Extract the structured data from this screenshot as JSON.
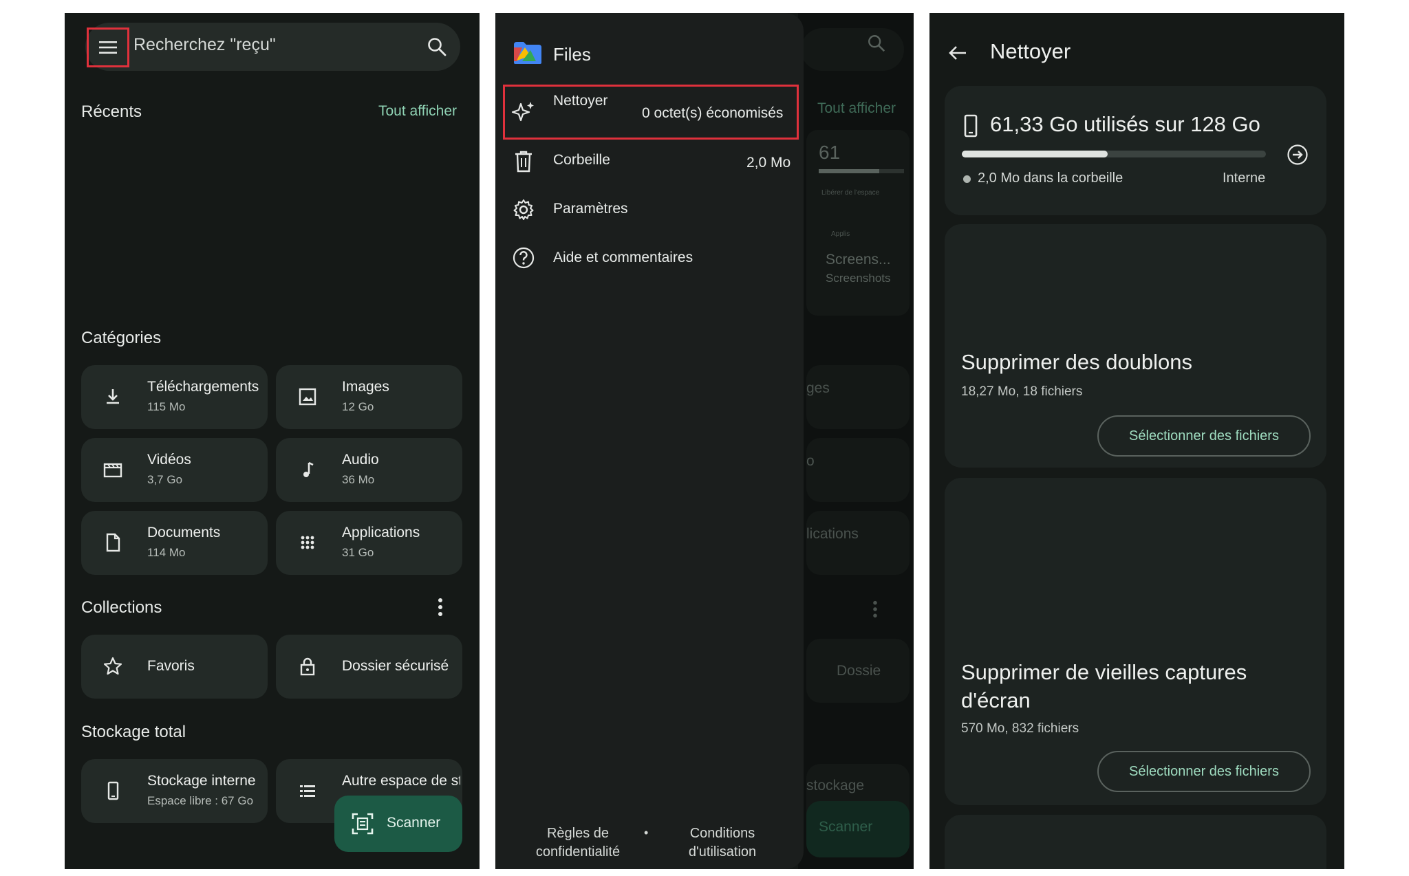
{
  "panel1": {
    "search": {
      "placeholder": "Recherchez \"reçu\""
    },
    "recents": {
      "title": "Récents",
      "action": "Tout afficher"
    },
    "categories": {
      "title": "Catégories",
      "items": [
        {
          "label": "Téléchargements",
          "size": "115 Mo",
          "icon": "download-icon"
        },
        {
          "label": "Images",
          "size": "12 Go",
          "icon": "image-icon"
        },
        {
          "label": "Vidéos",
          "size": "3,7 Go",
          "icon": "video-icon"
        },
        {
          "label": "Audio",
          "size": "36 Mo",
          "icon": "music-note-icon"
        },
        {
          "label": "Documents",
          "size": "114 Mo",
          "icon": "document-icon"
        },
        {
          "label": "Applications",
          "size": "31 Go",
          "icon": "apps-grid-icon"
        }
      ]
    },
    "collections": {
      "title": "Collections",
      "items": [
        {
          "label": "Favoris",
          "icon": "star-icon"
        },
        {
          "label": "Dossier sécurisé",
          "icon": "lock-icon"
        }
      ]
    },
    "storage": {
      "title": "Stockage total",
      "items": [
        {
          "label": "Stockage interne",
          "sub": "Espace libre : 67 Go",
          "icon": "phone-icon"
        },
        {
          "label": "Autre espace de stockage",
          "sub": "",
          "icon": "storage-list-icon"
        }
      ]
    },
    "fab": {
      "label": "Scanner",
      "icon": "document-scanner-icon"
    }
  },
  "panel2": {
    "app_title": "Files",
    "items": [
      {
        "label": "Nettoyer",
        "value": "0 octet(s) économisés",
        "icon": "sparkle-icon"
      },
      {
        "label": "Corbeille",
        "value": "2,0 Mo",
        "icon": "trash-icon"
      },
      {
        "label": "Paramètres",
        "value": "",
        "icon": "gear-icon"
      },
      {
        "label": "Aide et commentaires",
        "value": "",
        "icon": "help-icon"
      }
    ],
    "footer": {
      "privacy": "Règles de confidentialité",
      "separator": "•",
      "terms": "Conditions d'utilisation"
    },
    "background": {
      "tout_afficher": "Tout afficher",
      "storage_number": "61",
      "liberer": "Libérer de l'espace",
      "applis": "Applis",
      "screens": "Screens...",
      "screenshots": "Screenshots",
      "images_frag": "ges",
      "audio_frag": "o",
      "apps_frag": "lications",
      "dossier_frag": "Dossie",
      "stockage_frag": "stockage",
      "scanner": "Scanner"
    }
  },
  "panel3": {
    "title": "Nettoyer",
    "storage": {
      "headline": "61,33 Go utilisés sur 128 Go",
      "used_fraction": 0.479,
      "trash": "2,0 Mo dans la corbeille",
      "location": "Interne"
    },
    "cards": [
      {
        "title": "Supprimer des doublons",
        "subtitle": "18,27 Mo, 18 fichiers",
        "button": "Sélectionner des fichiers"
      },
      {
        "title": "Supprimer de vieilles captures d'écran",
        "subtitle": "570 Mo, 832 fichiers",
        "button": "Sélectionner des fichiers"
      }
    ]
  },
  "colors": {
    "background": "#151917",
    "accent": "#8fd3b4",
    "fab": "#1c5a45",
    "highlight": "#e0313c"
  }
}
